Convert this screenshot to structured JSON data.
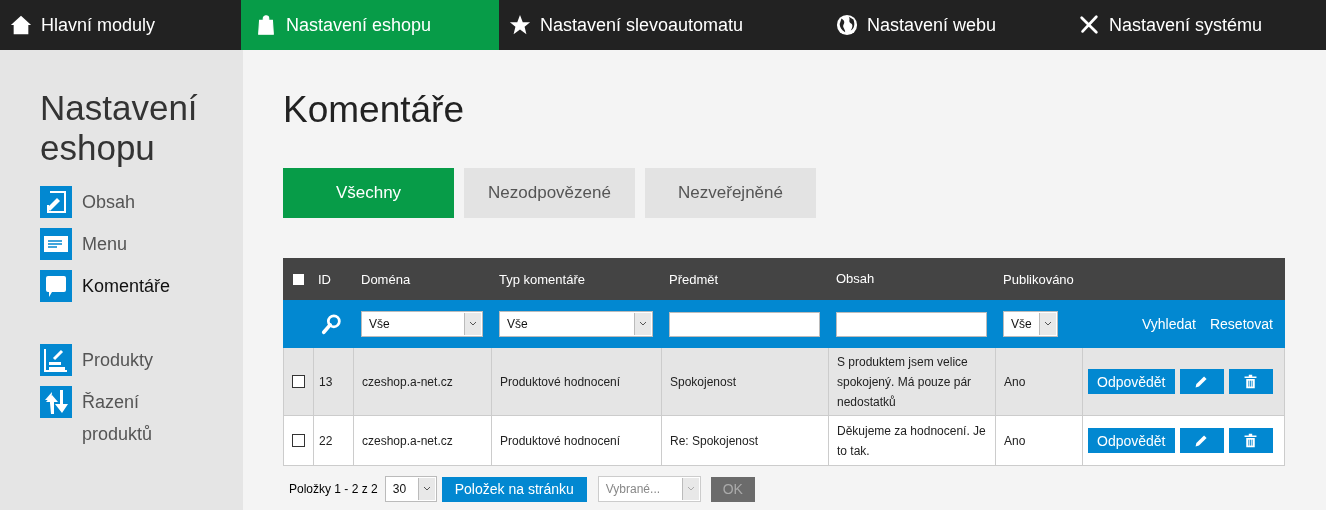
{
  "nav": [
    {
      "label": "Hlavní moduly",
      "selected": false
    },
    {
      "label": "Nastavení eshopu",
      "selected": true
    },
    {
      "label": "Nastavení slevoautomatu",
      "selected": false
    },
    {
      "label": "Nastavení webu",
      "selected": false
    },
    {
      "label": "Nastavení systému",
      "selected": false
    }
  ],
  "sidebar": {
    "title": "Nastavení eshopu",
    "groups": [
      [
        {
          "label": "Obsah",
          "selected": false
        },
        {
          "label": "Menu",
          "selected": false
        },
        {
          "label": "Komentáře",
          "selected": true
        }
      ],
      [
        {
          "label": "Produkty",
          "selected": false
        },
        {
          "label": "Řazení produktů",
          "selected": false
        }
      ]
    ]
  },
  "page_title": "Komentáře",
  "tabs": [
    {
      "label": "Všechny",
      "selected": true
    },
    {
      "label": "Nezodpovězené",
      "selected": false
    },
    {
      "label": "Nezveřejněné",
      "selected": false
    }
  ],
  "table": {
    "select_all_checked": false,
    "columns": [
      "ID",
      "Doména",
      "Typ komentáře",
      "Předmět",
      "Obsah",
      "Publikováno"
    ],
    "filters": [
      {
        "kind": "select",
        "value": "Vše"
      },
      {
        "kind": "select",
        "value": "Vše"
      },
      {
        "kind": "input"
      },
      {
        "kind": "input"
      },
      {
        "kind": "select",
        "value": "Vše"
      }
    ],
    "filter_actions": [
      "Vyhledat",
      "Resetovat"
    ],
    "rows": [
      {
        "checked": false,
        "highlighted": true,
        "cells": [
          "13",
          "czeshop.a-net.cz",
          "Produktové hodnocení",
          "Spokojenost",
          "S produktem jsem velice spokojený. Má pouze pár nedostatků",
          "Ano"
        ],
        "reply": "Odpovědět"
      },
      {
        "checked": false,
        "highlighted": false,
        "cells": [
          "22",
          "czeshop.a-net.cz",
          "Produktové hodnocení",
          "Re: Spokojenost",
          "Děkujeme za hodnocení. Je to tak.",
          "Ano"
        ],
        "reply": "Odpovědět"
      }
    ]
  },
  "pager": {
    "summary": "Položky 1 - 2 z 2",
    "per_page": "30",
    "per_page_button": "Položek na stránku",
    "bulk_placeholder": "Vybrané...",
    "bulk_disabled": true,
    "ok": "OK"
  }
}
